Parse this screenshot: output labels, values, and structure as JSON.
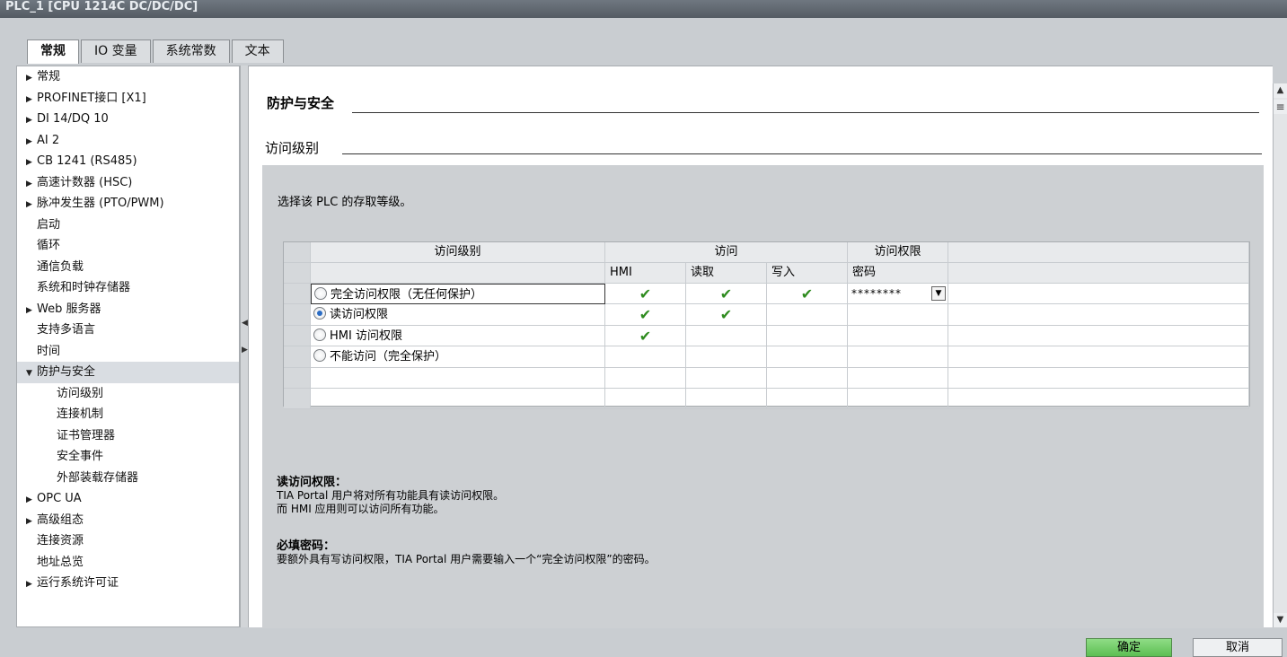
{
  "window": {
    "title": "PLC_1 [CPU 1214C DC/DC/DC]"
  },
  "tabs": [
    "常规",
    "IO 变量",
    "系统常数",
    "文本"
  ],
  "nav": {
    "items": [
      {
        "label": "常规",
        "arrow": "▶"
      },
      {
        "label": "PROFINET接口 [X1]",
        "arrow": "▶"
      },
      {
        "label": "DI 14/DQ 10",
        "arrow": "▶"
      },
      {
        "label": "AI 2",
        "arrow": "▶"
      },
      {
        "label": "CB 1241 (RS485)",
        "arrow": "▶"
      },
      {
        "label": "高速计数器 (HSC)",
        "arrow": "▶"
      },
      {
        "label": "脉冲发生器 (PTO/PWM)",
        "arrow": "▶"
      },
      {
        "label": "启动",
        "arrow": ""
      },
      {
        "label": "循环",
        "arrow": ""
      },
      {
        "label": "通信负载",
        "arrow": ""
      },
      {
        "label": "系统和时钟存储器",
        "arrow": ""
      },
      {
        "label": "Web 服务器",
        "arrow": "▶"
      },
      {
        "label": "支持多语言",
        "arrow": ""
      },
      {
        "label": "时间",
        "arrow": ""
      },
      {
        "label": "防护与安全",
        "arrow": "▼"
      },
      {
        "label": "访问级别",
        "arrow": ""
      },
      {
        "label": "连接机制",
        "arrow": ""
      },
      {
        "label": "证书管理器",
        "arrow": ""
      },
      {
        "label": "安全事件",
        "arrow": ""
      },
      {
        "label": "外部装载存储器",
        "arrow": ""
      },
      {
        "label": "OPC UA",
        "arrow": "▶"
      },
      {
        "label": "高级组态",
        "arrow": "▶"
      },
      {
        "label": "连接资源",
        "arrow": ""
      },
      {
        "label": "地址总览",
        "arrow": ""
      },
      {
        "label": "运行系统许可证",
        "arrow": "▶"
      }
    ]
  },
  "main": {
    "section_title": "防护与安全",
    "sub_title": "访问级别",
    "instruction": "选择该 PLC 的存取等级。",
    "grid": {
      "headers": {
        "level": "访问级别",
        "access": "访问",
        "permission": "访问权限"
      },
      "subheaders": {
        "hmi": "HMI",
        "read": "读取",
        "write": "写入",
        "password": "密码"
      },
      "rows": [
        {
          "label": "完全访问权限（无任何保护）",
          "checked": false,
          "hmi": "✔",
          "read": "✔",
          "write": "✔",
          "password": "********"
        },
        {
          "label": "读访问权限",
          "checked": true,
          "hmi": "✔",
          "read": "✔",
          "write": "",
          "password": ""
        },
        {
          "label": "HMI 访问权限",
          "checked": false,
          "hmi": "✔",
          "read": "",
          "write": "",
          "password": ""
        },
        {
          "label": "不能访问（完全保护）",
          "checked": false,
          "hmi": "",
          "read": "",
          "write": "",
          "password": ""
        }
      ]
    },
    "note1": {
      "title": "读访问权限：",
      "line1": "TIA Portal 用户将对所有功能具有读访问权限。",
      "line2": "而 HMI 应用则可以访问所有功能。"
    },
    "note2": {
      "title": "必填密码：",
      "line1": "要额外具有写访问权限，TIA Portal 用户需要输入一个“完全访问权限”的密码。"
    }
  },
  "buttons": {
    "ok": "确定",
    "cancel": "取消"
  },
  "colors": {
    "accent_green": "#5cbf52",
    "check_green": "#2e8b1e",
    "radio_blue": "#2b6cc4"
  }
}
